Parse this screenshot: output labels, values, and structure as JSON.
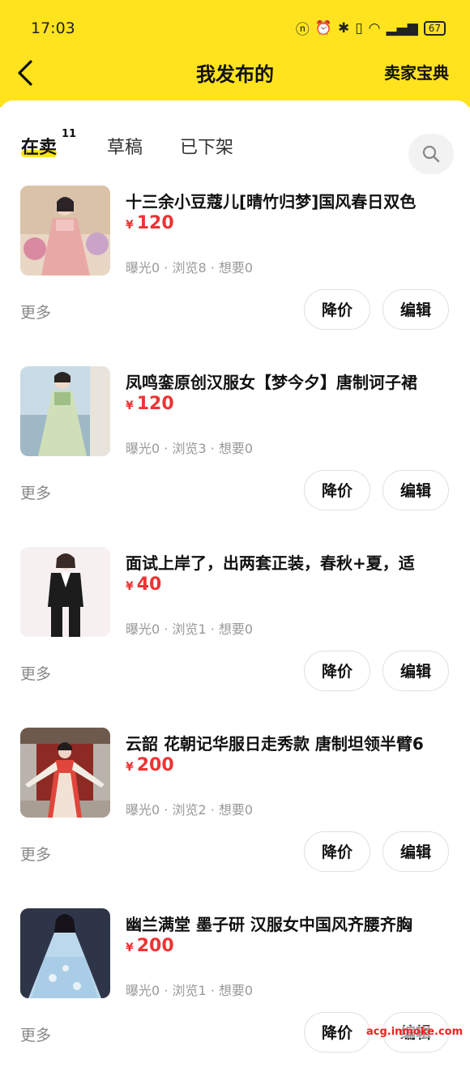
{
  "status_bar": {
    "time": "17:03",
    "battery": "67",
    "network": "4G"
  },
  "nav": {
    "title": "我发布的",
    "right_link": "卖家宝典"
  },
  "tabs": [
    {
      "label": "在卖",
      "count": "11",
      "active": true
    },
    {
      "label": "草稿"
    },
    {
      "label": "已下架"
    }
  ],
  "items": [
    {
      "title": "十三余小豆蔻儿[晴竹归梦]国风春日双色",
      "currency": "¥",
      "price": "120",
      "stats": "曝光0 · 浏览8 · 想要0",
      "more": "更多",
      "btn_reduce": "降价",
      "btn_edit": "编辑"
    },
    {
      "title": "凤鸣銮原创汉服女【梦今夕】唐制诃子裙",
      "currency": "¥",
      "price": "120",
      "stats": "曝光0 · 浏览3 · 想要0",
      "more": "更多",
      "btn_reduce": "降价",
      "btn_edit": "编辑"
    },
    {
      "title": "面试上岸了，出两套正装，春秋+夏，适",
      "currency": "¥",
      "price": "40",
      "stats": "曝光0 · 浏览1 · 想要0",
      "more": "更多",
      "btn_reduce": "降价",
      "btn_edit": "编辑"
    },
    {
      "title": "云韶 花朝记华服日走秀款 唐制坦领半臂6",
      "currency": "¥",
      "price": "200",
      "stats": "曝光0 · 浏览2 · 想要0",
      "more": "更多",
      "btn_reduce": "降价",
      "btn_edit": "编辑"
    },
    {
      "title": "幽兰满堂 墨子研 汉服女中国风齐腰齐胸",
      "currency": "¥",
      "price": "200",
      "stats": "曝光0 · 浏览1 · 想要0",
      "more": "更多",
      "btn_reduce": "降价",
      "btn_edit": "编辑"
    }
  ],
  "watermark": "acg.inmoke.com",
  "colors": {
    "header": "#ffe31e",
    "price": "#ee3333",
    "muted": "#999999"
  }
}
